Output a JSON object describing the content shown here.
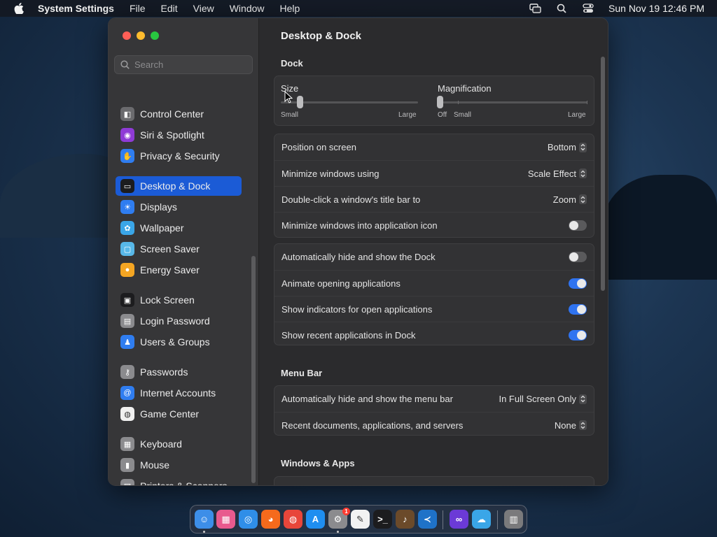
{
  "menubar": {
    "app_name": "System Settings",
    "menus": [
      "File",
      "Edit",
      "View",
      "Window",
      "Help"
    ],
    "clock": "Sun Nov 19  12:46 PM"
  },
  "sidebar": {
    "search_placeholder": "Search",
    "items": [
      {
        "label": "Control Center",
        "icon": "control-center-icon",
        "color": "#6b6b6e"
      },
      {
        "label": "Siri & Spotlight",
        "icon": "siri-icon",
        "color": "#8f3bd6"
      },
      {
        "label": "Privacy & Security",
        "icon": "hand-icon",
        "color": "#2f7df0"
      },
      {
        "label": "Desktop & Dock",
        "icon": "dock-icon",
        "color": "#1c1c1e"
      },
      {
        "label": "Displays",
        "icon": "sun-icon",
        "color": "#2f7df0"
      },
      {
        "label": "Wallpaper",
        "icon": "flower-icon",
        "color": "#3aa6e8"
      },
      {
        "label": "Screen Saver",
        "icon": "screen-saver-icon",
        "color": "#58b8e8"
      },
      {
        "label": "Energy Saver",
        "icon": "bulb-icon",
        "color": "#f5a623"
      },
      {
        "label": "Lock Screen",
        "icon": "lock-icon",
        "color": "#1c1c1e"
      },
      {
        "label": "Login Password",
        "icon": "padlock-icon",
        "color": "#8b8b8e"
      },
      {
        "label": "Users & Groups",
        "icon": "users-icon",
        "color": "#2f7df0"
      },
      {
        "label": "Passwords",
        "icon": "key-icon",
        "color": "#8b8b8e"
      },
      {
        "label": "Internet Accounts",
        "icon": "at-icon",
        "color": "#2f7df0"
      },
      {
        "label": "Game Center",
        "icon": "game-center-icon",
        "color": "#f0f0f0"
      },
      {
        "label": "Keyboard",
        "icon": "keyboard-icon",
        "color": "#8b8b8e"
      },
      {
        "label": "Mouse",
        "icon": "mouse-icon",
        "color": "#8b8b8e"
      },
      {
        "label": "Printers & Scanners",
        "icon": "printer-icon",
        "color": "#8b8b8e"
      }
    ],
    "active_index": 3
  },
  "main": {
    "title": "Desktop & Dock",
    "dock_section": "Dock",
    "size_label": "Size",
    "size_min": "Small",
    "size_max": "Large",
    "size_value": 0.0,
    "magnification_label": "Magnification",
    "mag_off": "Off",
    "mag_min": "Small",
    "mag_max": "Large",
    "mag_value": 0.0,
    "dock_rows": [
      {
        "label": "Position on screen",
        "value": "Bottom"
      },
      {
        "label": "Minimize windows using",
        "value": "Scale Effect"
      },
      {
        "label": "Double-click a window's title bar to",
        "value": "Zoom"
      },
      {
        "label": "Minimize windows into application icon",
        "toggle": false
      }
    ],
    "dock_toggles": [
      {
        "label": "Automatically hide and show the Dock",
        "toggle": false
      },
      {
        "label": "Animate opening applications",
        "toggle": true
      },
      {
        "label": "Show indicators for open applications",
        "toggle": true
      },
      {
        "label": "Show recent applications in Dock",
        "toggle": true
      }
    ],
    "menubar_section": "Menu Bar",
    "menubar_rows": [
      {
        "label": "Automatically hide and show the menu bar",
        "value": "In Full Screen Only"
      },
      {
        "label": "Recent documents, applications, and servers",
        "value": "None"
      }
    ],
    "windows_section": "Windows & Apps"
  },
  "dock": {
    "apps": [
      "Finder",
      "Launchpad",
      "Safari",
      "Firefox",
      "Chrome",
      "App Store",
      "System Settings",
      "TextEdit",
      "Terminal",
      "Instruments",
      "VS Code",
      "Visual Studio",
      "CloudMounter",
      "Trash"
    ],
    "badge": "1"
  },
  "colors": {
    "accent": "#1b5bd6",
    "toggle_on": "#2f73f0"
  }
}
